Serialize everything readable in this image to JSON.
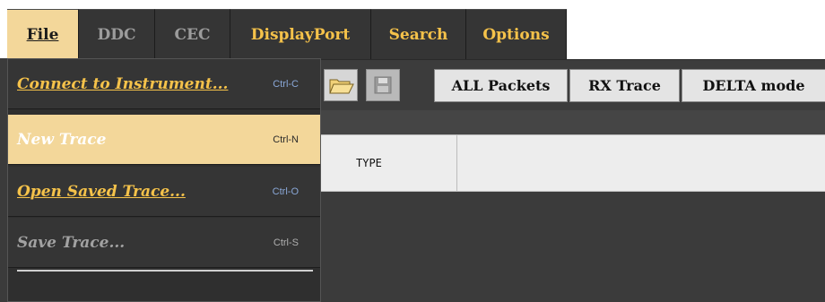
{
  "menubar": {
    "items": [
      {
        "label": "File",
        "state": "active"
      },
      {
        "label": "DDC",
        "state": "disabled"
      },
      {
        "label": "CEC",
        "state": "disabled"
      },
      {
        "label": "DisplayPort",
        "state": "normal"
      },
      {
        "label": "Search",
        "state": "normal"
      },
      {
        "label": "Options",
        "state": "normal"
      }
    ]
  },
  "toolbar": {
    "open_icon": "folder-open-icon",
    "save_icon": "floppy-save-icon",
    "buttons": [
      "ALL Packets",
      "RX Trace",
      "DELTA mode"
    ]
  },
  "grid": {
    "columns": [
      "TYPE"
    ]
  },
  "file_menu": {
    "items": [
      {
        "label": "Connect to Instrument...",
        "shortcut": "Ctrl-C",
        "state": "normal"
      },
      {
        "label": "New Trace",
        "shortcut": "Ctrl-N",
        "state": "highlighted"
      },
      {
        "label": "Open Saved Trace...",
        "shortcut": "Ctrl-O",
        "state": "normal"
      },
      {
        "label": "Save Trace...",
        "shortcut": "Ctrl-S",
        "state": "disabled"
      }
    ]
  },
  "colors": {
    "menu_text": "#f5c24a",
    "menu_bg": "#353535",
    "highlight_bg": "#f3d79a",
    "disabled_text": "#9c9c9c"
  }
}
